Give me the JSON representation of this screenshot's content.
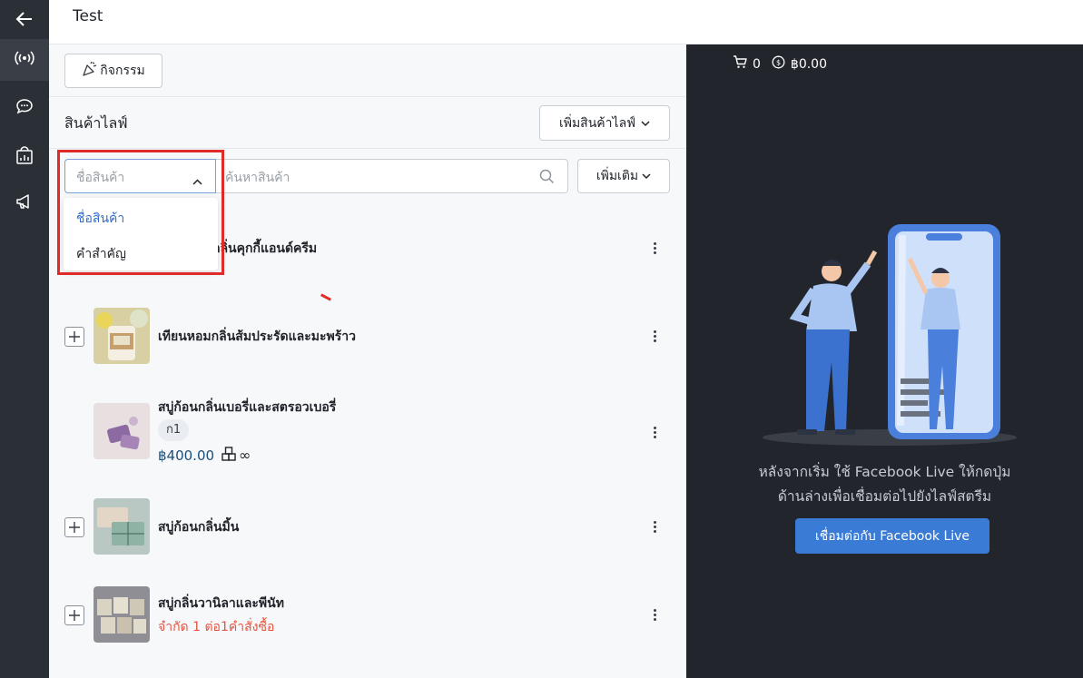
{
  "window": {
    "title": "Test"
  },
  "left_rail": {
    "items": [
      {
        "icon": "back-arrow-icon"
      },
      {
        "icon": "live-broadcast-icon",
        "active": true
      },
      {
        "icon": "chat-bubble-icon"
      },
      {
        "icon": "store-analytics-icon"
      },
      {
        "icon": "megaphone-icon"
      }
    ]
  },
  "toolbar": {
    "activity_label": "กิจกรรม"
  },
  "products_section": {
    "title": "สินค้าไลฟ์",
    "add_live_label": "เพิ่มสินค้าไลฟ์",
    "filter": {
      "selected": "ชื่อสินค้า",
      "options": [
        "ชื่อสินค้า",
        "คำสำคัญ"
      ]
    },
    "search_placeholder": "ค้นหาสินค้า",
    "more_label": "เพิ่มเติม",
    "items": [
      {
        "name_visible": "กลิ่นคุกกี้แอนด์ครีม"
      },
      {
        "name": "เทียนหอมกลิ่นส้มประรัดและมะพร้าว"
      },
      {
        "name": "สบู่ก้อนกลิ่นเบอรี่และสตรอวเบอรี่",
        "tag": "ก1",
        "price": "฿400.00",
        "stock": "∞"
      },
      {
        "name": "สบู่ก้อนกลิ่นมิ้น"
      },
      {
        "name": "สบู่กลิ่นวานิลาและพีนัท",
        "limit": "จำกัด 1 ต่อ1คำสั่งซื้อ"
      }
    ]
  },
  "live_panel": {
    "cart_count": "0",
    "cart_total": "฿0.00",
    "description_line1": "หลังจากเริ่ม ใช้ Facebook Live ให้กดปุ่ม",
    "description_line2": "ด้านล่างเพื่อเชื่อมต่อไปยังไลฟ์สตรีม",
    "connect_label": "เชื่อมต่อกับ Facebook Live"
  },
  "colors": {
    "rail_bg": "#2b2f36",
    "panel_dark": "#22262c",
    "accent": "#3a7bd5",
    "price": "#1a4f7a",
    "limit": "#e5533d",
    "highlight_box": "#e02b2b"
  }
}
